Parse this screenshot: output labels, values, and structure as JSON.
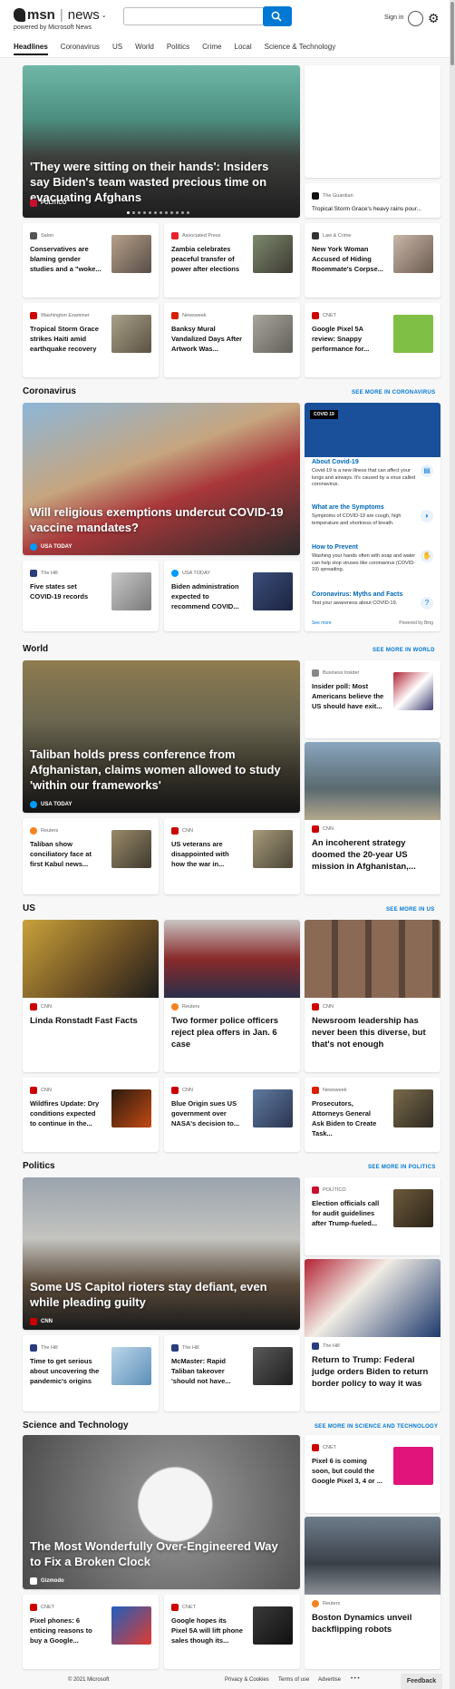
{
  "header": {
    "brand": "msn",
    "product": "news",
    "powered": "powered by Microsoft News",
    "search_placeholder": "",
    "signin": "Sign in"
  },
  "nav": [
    "Headlines",
    "Coronavirus",
    "US",
    "World",
    "Politics",
    "Crime",
    "Local",
    "Science & Technology"
  ],
  "headlines": {
    "hero": {
      "title": "'They were sitting on their hands': Insiders say Biden's team wasted precious time on evacuating Afghans",
      "source": "POLITICO"
    },
    "side": {
      "source": "The Guardian",
      "title": "Tropical Storm Grace's heavy rains pour..."
    },
    "row1": [
      {
        "source": "Salon",
        "title": "Conservatives are blaming gender studies and a \"woke..."
      },
      {
        "source": "Associated Press",
        "title": "Zambia celebrates peaceful transfer of power after elections"
      },
      {
        "source": "Law & Crime",
        "title": "New York Woman Accused of Hiding Roommate's Corpse..."
      }
    ],
    "row2": [
      {
        "source": "Washington Examiner",
        "title": "Tropical Storm Grace strikes Haiti amid earthquake recovery"
      },
      {
        "source": "Newsweek",
        "title": "Banksy Mural Vandalized Days After Artwork Was..."
      },
      {
        "source": "CNET",
        "title": "Google Pixel 5A review: Snappy performance for..."
      }
    ]
  },
  "coronavirus": {
    "label": "Coronavirus",
    "more": "SEE MORE IN CORONAVIRUS",
    "hero": {
      "title": "Will religious exemptions undercut COVID-19 vaccine mandates?",
      "source": "USA TODAY"
    },
    "cards": [
      {
        "source": "The Hill",
        "title": "Five states set COVID-19 records"
      },
      {
        "source": "USA TODAY",
        "title": "Biden administration expected to recommend COVID..."
      }
    ],
    "panel": {
      "tag": "COVID 19",
      "items": [
        {
          "title": "About Covid-19",
          "desc": "Covid-19 is a new illness that can affect your lungs and airways. It's caused by a virus called coronavirus."
        },
        {
          "title": "What are the Symptoms",
          "desc": "Symptoms of COVID-19 are cough, high temperature and shortness of breath."
        },
        {
          "title": "How to Prevent",
          "desc": "Washing your hands often with soap and water can help stop viruses like coronavirus (COVID-19) spreading."
        },
        {
          "title": "Coronavirus: Myths and Facts",
          "desc": "Test your awareness about COVID-19."
        }
      ],
      "see_more": "See more",
      "powered": "Powered by Bing"
    }
  },
  "world": {
    "label": "World",
    "more": "SEE MORE IN WORLD",
    "hero": {
      "title": "Taliban holds press conference from Afghanistan, claims women allowed to study 'within our frameworks'",
      "source": "USA TODAY"
    },
    "side": {
      "source": "Business Insider",
      "title": "Insider poll: Most Americans believe the US should have exit..."
    },
    "cards": [
      {
        "source": "Reuters",
        "title": "Taliban show conciliatory face at first Kabul news..."
      },
      {
        "source": "CNN",
        "title": "US veterans are disappointed with how the war in..."
      }
    ],
    "tall": {
      "source": "CNN",
      "title": "An incoherent strategy doomed the 20-year US mission in Afghanistan,..."
    }
  },
  "us": {
    "label": "US",
    "more": "SEE MORE IN US",
    "tall": [
      {
        "source": "CNN",
        "title": "Linda Ronstadt Fast Facts"
      },
      {
        "source": "Reuters",
        "title": "Two former police officers reject plea offers in Jan. 6 case"
      },
      {
        "source": "CNN",
        "title": "Newsroom leadership has never been this diverse, but that's not enough"
      }
    ],
    "cards": [
      {
        "source": "CNN",
        "title": "Wildfires Update: Dry conditions expected to continue in the..."
      },
      {
        "source": "CNN",
        "title": "Blue Origin sues US government over NASA's decision to..."
      },
      {
        "source": "Newsweek",
        "title": "Prosecutors, Attorneys General Ask Biden to Create Task..."
      }
    ]
  },
  "politics": {
    "label": "Politics",
    "more": "SEE MORE IN POLITICS",
    "hero": {
      "title": "Some US Capitol rioters stay defiant, even while pleading guilty",
      "source": "CNN"
    },
    "side": {
      "source": "POLITICO",
      "title": "Election officials call for audit guidelines after Trump-fueled..."
    },
    "cards": [
      {
        "source": "The Hill",
        "title": "Time to get serious about uncovering the pandemic's origins"
      },
      {
        "source": "The Hill",
        "title": "McMaster: Rapid Taliban takeover 'should not have..."
      }
    ],
    "tall": {
      "source": "The Hill",
      "title": "Return to Trump: Federal judge orders Biden to return border policy to way it was"
    }
  },
  "science": {
    "label": "Science and Technology",
    "more": "SEE MORE IN SCIENCE AND TECHNOLOGY",
    "hero": {
      "title": "The Most Wonderfully Over-Engineered Way to Fix a Broken Clock",
      "source": "Gizmodo"
    },
    "side": {
      "source": "CNET",
      "title": "Pixel 6 is coming soon, but could the Google Pixel 3, 4 or ..."
    },
    "cards": [
      {
        "source": "CNET",
        "title": "Pixel phones: 6 enticing reasons to buy a Google..."
      },
      {
        "source": "CNET",
        "title": "Google hopes its Pixel 5A will lift phone sales though its..."
      }
    ],
    "tall": {
      "source": "Reuters",
      "title": "Boston Dynamics unveil backflipping robots"
    }
  },
  "footer": {
    "copyright": "© 2021 Microsoft",
    "links": [
      "Privacy & Cookies",
      "Terms of use",
      "Advertise"
    ],
    "more": "• • •",
    "feedback": "Feedback"
  }
}
